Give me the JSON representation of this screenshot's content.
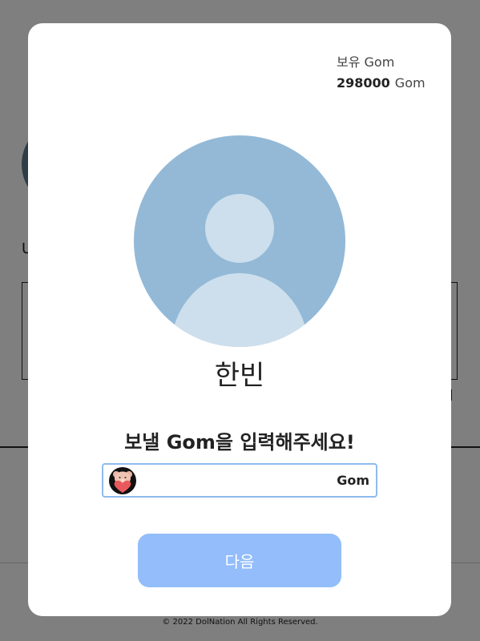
{
  "background": {
    "letter": "U",
    "footer": "© 2022 DolNation All Rights Reserved."
  },
  "modal": {
    "balance": {
      "label": "보유 Gom",
      "amount": "298000",
      "unit": "Gom"
    },
    "recipient_name": "한빈",
    "prompt": "보낼 Gom을 입력해주세요!",
    "amount_field": {
      "value": "",
      "placeholder": "",
      "unit": "Gom"
    },
    "next_label": "다음"
  },
  "colors": {
    "accent_blue": "#93bdfb",
    "field_border": "#8fbaf0",
    "avatar_bg": "#93b9d7",
    "avatar_fg": "#cddfec"
  },
  "icons": [
    "default-profile-icon",
    "bear-heart-icon"
  ]
}
